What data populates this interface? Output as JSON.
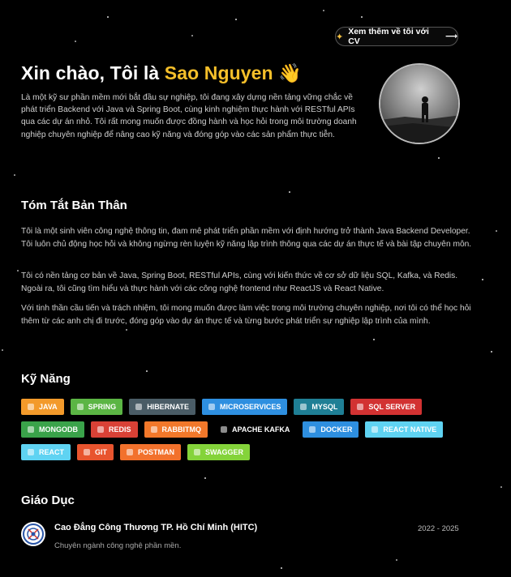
{
  "cv_button": {
    "label": "Xem thêm về tôi với CV",
    "arrow": "⟶",
    "icon": "sparkles-icon"
  },
  "hero": {
    "greeting": "Xin chào, Tôi là",
    "name": "Sao Nguyen",
    "emoji": "👋",
    "description": "Là một kỹ sư phần mềm mới bắt đầu sự nghiệp, tôi đang xây dựng nền tảng vững chắc về phát triển Backend với Java và Spring Boot, cùng kinh nghiệm thực hành với RESTful APIs qua các dự án nhỏ. Tôi rất mong muốn được đồng hành và học hỏi trong môi trường doanh nghiệp chuyên nghiệp để nâng cao kỹ năng và đóng góp vào các sản phẩm thực tiễn.",
    "name_color": "#f5bf2a"
  },
  "summary": {
    "title": "Tóm Tắt Bản Thân",
    "paragraphs": [
      "Tôi là một sinh viên công nghệ thông tin, đam mê phát triển phần mềm với định hướng trở thành Java Backend Developer. Tôi luôn chủ động học hỏi và không ngừng rèn luyện kỹ năng lập trình thông qua các dự án thực tế và bài tập chuyên môn.",
      "Tôi có nền tảng cơ bản về Java, Spring Boot, RESTful APIs, cùng với kiến thức về cơ sở dữ liệu SQL, Kafka, và Redis. Ngoài ra, tôi cũng tìm hiểu và thực hành với các công nghệ frontend như ReactJS và React Native.",
      "Với tinh thần cầu tiến và trách nhiệm, tôi mong muốn được làm việc trong môi trường chuyên nghiệp, nơi tôi có thể học hỏi thêm từ các anh chị đi trước, đóng góp vào dự án thực tế và từng bước phát triển sự nghiệp lập trình của mình."
    ]
  },
  "skills": {
    "title": "Kỹ Năng",
    "rows": [
      [
        {
          "label": "JAVA",
          "color": "#f39a2b"
        },
        {
          "label": "SPRING",
          "color": "#5bb544"
        },
        {
          "label": "HIBERNATE",
          "color": "#4a5c66"
        },
        {
          "label": "MICROSERVICES",
          "color": "#2e8fe0"
        },
        {
          "label": "MYSQL",
          "color": "#1f7f95"
        },
        {
          "label": "SQL SERVER",
          "color": "#d23232"
        }
      ],
      [
        {
          "label": "MONGODB",
          "color": "#3aa34a"
        },
        {
          "label": "REDIS",
          "color": "#d94136"
        },
        {
          "label": "RABBITMQ",
          "color": "#f2782a"
        },
        {
          "label": "APACHE KAFKA",
          "color": "#000000"
        },
        {
          "label": "DOCKER",
          "color": "#2e8fe0"
        },
        {
          "label": "REACT NATIVE",
          "color": "#5fd3f2"
        }
      ],
      [
        {
          "label": "REACT",
          "color": "#5fd3f2"
        },
        {
          "label": "GIT",
          "color": "#e8542e"
        },
        {
          "label": "POSTMAN",
          "color": "#f2712c"
        },
        {
          "label": "SWAGGER",
          "color": "#84d33a"
        }
      ]
    ]
  },
  "education": {
    "title": "Giáo Dục",
    "school": "Cao Đẳng Công Thương TP. Hồ Chí Minh (HITC)",
    "years": "2022 - 2025",
    "major": "Chuyên ngành công nghệ phần mền."
  }
}
